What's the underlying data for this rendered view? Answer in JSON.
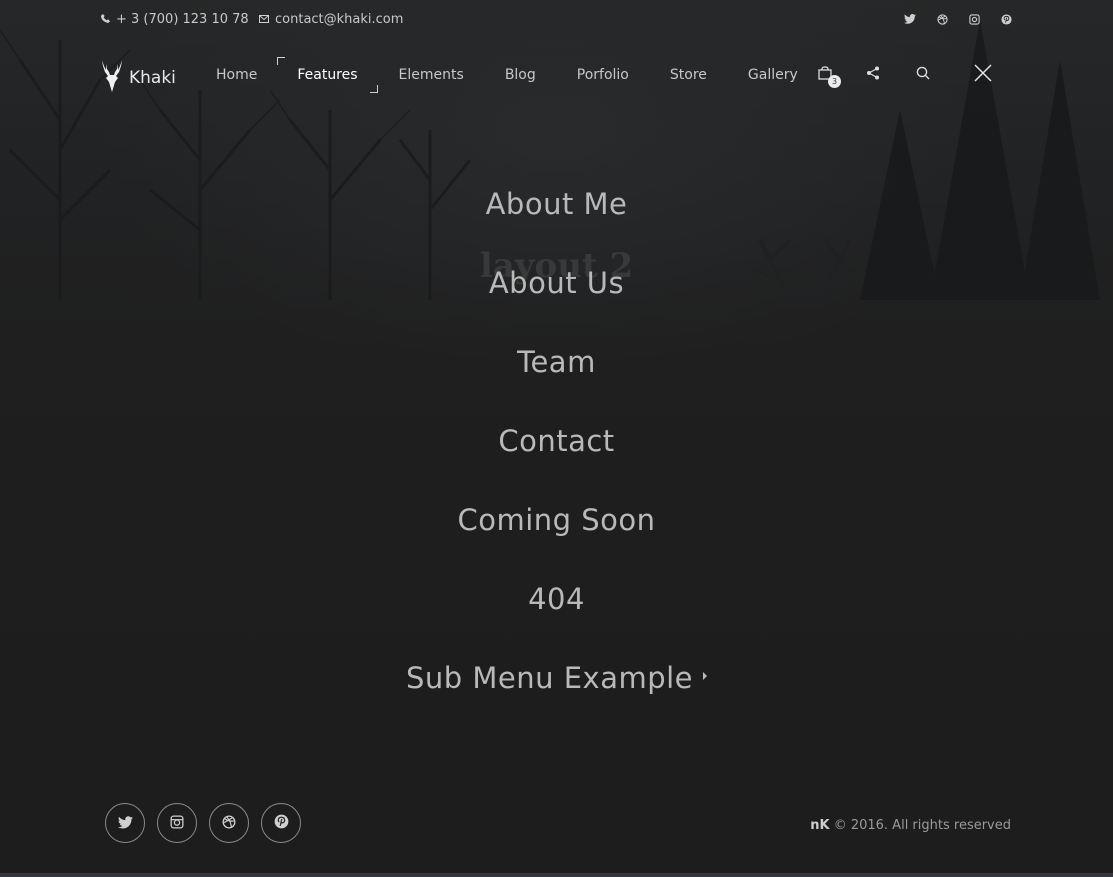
{
  "topbar": {
    "phone": "+ 3 (700) 123 10 78",
    "email": "contact@khaki.com",
    "socials": [
      "twitter-icon",
      "dribbble-icon",
      "instagram-icon",
      "pinterest-icon"
    ]
  },
  "brand": {
    "name": "Khaki"
  },
  "nav": {
    "items": [
      {
        "label": "Home"
      },
      {
        "label": "Features"
      },
      {
        "label": "Elements"
      },
      {
        "label": "Blog"
      },
      {
        "label": "Porfolio"
      },
      {
        "label": "Store"
      },
      {
        "label": "Gallery"
      }
    ],
    "active": "Features",
    "cart_count": "3"
  },
  "background": {
    "ghost_text": "layout 2"
  },
  "center_menu": {
    "items": [
      {
        "label": "About Me"
      },
      {
        "label": "About Us"
      },
      {
        "label": "Team"
      },
      {
        "label": "Contact"
      },
      {
        "label": "Coming Soon"
      },
      {
        "label": "404"
      },
      {
        "label": "Sub Menu Example"
      }
    ]
  },
  "footer": {
    "socials": [
      "twitter-icon",
      "instagram-icon",
      "dribbble-icon",
      "pinterest-icon"
    ],
    "brand": "nK",
    "copyright": "© 2016. All rights reserved"
  },
  "colors": {
    "background": "#262626",
    "text": "#bdbdbd",
    "accent": "#ffffff"
  }
}
